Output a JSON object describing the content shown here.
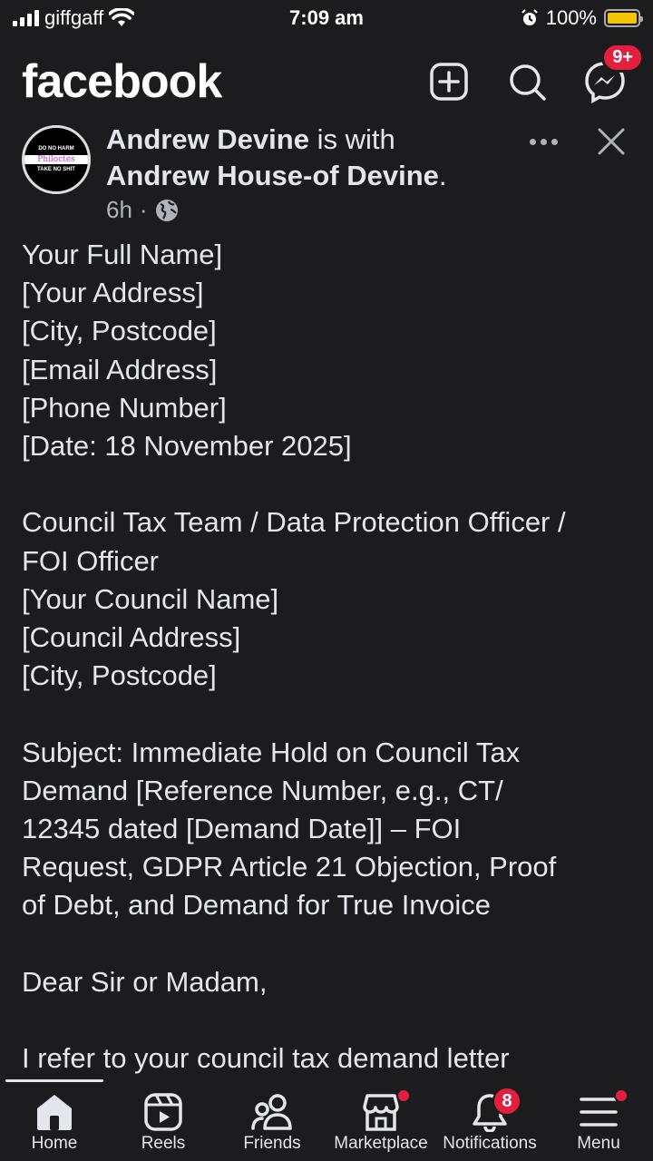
{
  "status_bar": {
    "carrier": "giffgaff",
    "time": "7:09 am",
    "battery": "100%",
    "battery_level": 1.0
  },
  "header": {
    "logo": "facebook",
    "messenger_badge": "9+",
    "icons": [
      "plus-square-icon",
      "search-icon",
      "messenger-icon"
    ]
  },
  "post": {
    "author": "Andrew Devine",
    "with_text": " is with",
    "tagged": "Andrew House-of Devine",
    "tagged_suffix": ".",
    "time": "6h",
    "separator": "·",
    "avatar": {
      "top_text": "DO NO HARM",
      "middle_text": "Philoctes",
      "bottom_text": "TAKE NO SHIT"
    },
    "body": [
      [
        "Your Full Name]",
        "[Your Address]",
        "[City, Postcode]",
        "[Email Address]",
        "[Phone Number]",
        "[Date: 18 November 2025]"
      ],
      [
        "Council Tax Team / Data Protection Officer /",
        "FOI Officer",
        "[Your Council Name]",
        "[Council Address]",
        "[City, Postcode]"
      ],
      [
        "Subject: Immediate Hold on Council Tax",
        "Demand [Reference Number, e.g., CT/",
        "12345 dated [Demand Date]] – FOI",
        "Request, GDPR Article 21 Objection, Proof",
        "of Debt, and Demand for True Invoice"
      ],
      [
        "Dear Sir or Madam,"
      ],
      [
        "I refer to your council tax demand letter"
      ]
    ]
  },
  "bottom_nav": {
    "items": [
      {
        "label": "Home",
        "icon": "home-icon"
      },
      {
        "label": "Reels",
        "icon": "reels-icon"
      },
      {
        "label": "Friends",
        "icon": "friends-icon"
      },
      {
        "label": "Marketplace",
        "icon": "marketplace-icon"
      },
      {
        "label": "Notifications",
        "icon": "bell-icon",
        "badge": "8"
      },
      {
        "label": "Menu",
        "icon": "menu-icon"
      }
    ]
  },
  "colors": {
    "background": "#1c1c1e",
    "text": "#e4e6eb",
    "badge": "#e41e3f",
    "battery": "#f5c400"
  }
}
